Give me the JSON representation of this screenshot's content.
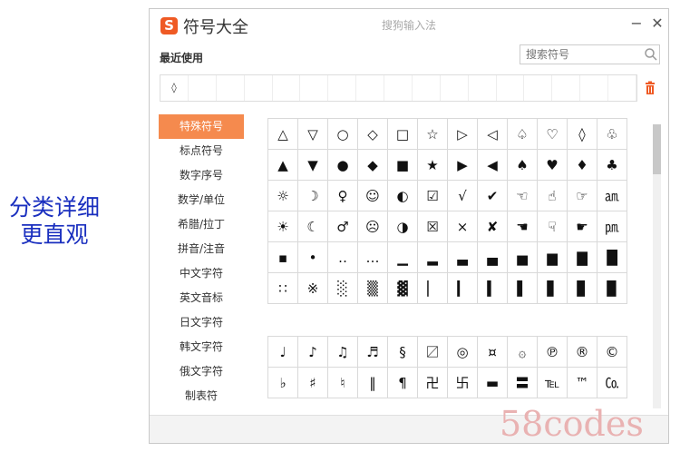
{
  "promo_lines": [
    "分类详细",
    "更直观"
  ],
  "window": {
    "title": "符号大全",
    "subtitle": "搜狗输入法",
    "logo": "S",
    "minimize": "−",
    "close": "✕"
  },
  "recent": {
    "label": "最近使用",
    "first_symbol": "◊",
    "trash_color": "#ef5a24"
  },
  "search": {
    "placeholder": "搜索符号"
  },
  "categories": [
    "特殊符号",
    "标点符号",
    "数字序号",
    "数学/单位",
    "希腊/拉丁",
    "拼音/注音",
    "中文字符",
    "英文音标",
    "日文字符",
    "韩文字符",
    "俄文字符",
    "制表符"
  ],
  "active_category": 0,
  "accent_color": "#f58a4e",
  "grid1": [
    [
      "△",
      "▽",
      "○",
      "◇",
      "□",
      "☆",
      "▷",
      "◁",
      "♤",
      "♡",
      "◊",
      "♧"
    ],
    [
      "▲",
      "▼",
      "●",
      "◆",
      "■",
      "★",
      "▶",
      "◀",
      "♠",
      "♥",
      "♦",
      "♣"
    ],
    [
      "☼",
      "☽",
      "♀",
      "☺",
      "◐",
      "☑",
      "√",
      "✔",
      "☜",
      "☝",
      "☞",
      "㏂"
    ],
    [
      "☀",
      "☾",
      "♂",
      "☹",
      "◑",
      "☒",
      "×",
      "✘",
      "☚",
      "☟",
      "☛",
      "㏘"
    ],
    [
      "▪",
      "•",
      "‥",
      "…",
      "▁",
      "▂",
      "▃",
      "▄",
      "▅",
      "▆",
      "▇",
      "█"
    ],
    [
      "∷",
      "※",
      "░",
      "▒",
      "▓",
      "▏",
      "▎",
      "▍",
      "▌",
      "▋",
      "▊",
      "▉"
    ]
  ],
  "grid2": [
    [
      "♩",
      "♪",
      "♫",
      "♬",
      "§",
      "〼",
      "◎",
      "¤",
      "۞",
      "℗",
      "®",
      "©"
    ],
    [
      "♭",
      "♯",
      "♮",
      "‖",
      "¶",
      "卍",
      "卐",
      "▬",
      "〓",
      "℡",
      "™",
      "㏇"
    ]
  ],
  "watermark": "58codes"
}
